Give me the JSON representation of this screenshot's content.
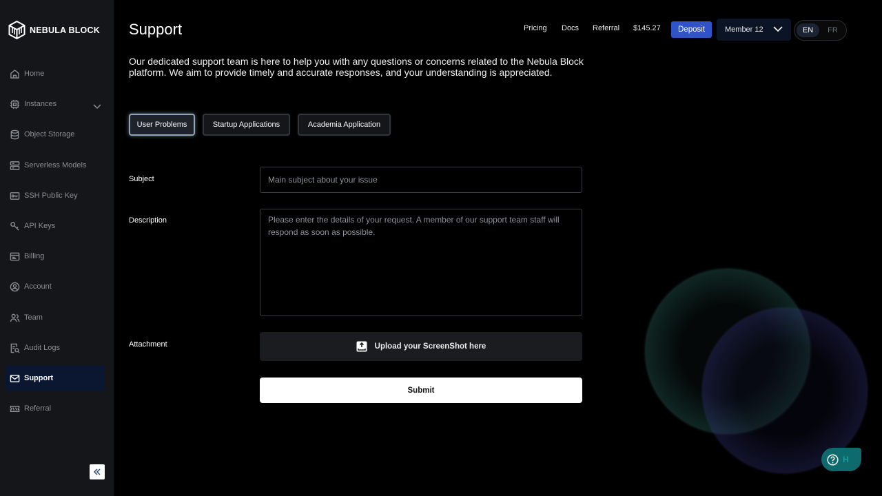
{
  "brand": {
    "name": "NEBULA BLOCK"
  },
  "sidebar": {
    "items": [
      {
        "label": "Home",
        "icon": "home-icon"
      },
      {
        "label": "Instances",
        "icon": "chip-icon"
      },
      {
        "label": "Object Storage",
        "icon": "database-icon"
      },
      {
        "label": "Serverless Models",
        "icon": "server-icon"
      },
      {
        "label": "SSH Public Key",
        "icon": "key-card-icon"
      },
      {
        "label": "API Keys",
        "icon": "key-icon"
      },
      {
        "label": "Billing",
        "icon": "billing-icon"
      },
      {
        "label": "Account",
        "icon": "user-circle-icon"
      },
      {
        "label": "Team",
        "icon": "team-icon"
      },
      {
        "label": "Audit Logs",
        "icon": "audit-icon"
      },
      {
        "label": "Support",
        "icon": "mail-icon",
        "active": true
      },
      {
        "label": "Referral",
        "icon": "ticket-icon"
      }
    ]
  },
  "header": {
    "title": "Support",
    "links": {
      "pricing": "Pricing",
      "docs": "Docs",
      "referral": "Referral"
    },
    "balance": "$145.27",
    "deposit": "Deposit",
    "member": "Member 12",
    "lang": {
      "en": "EN",
      "fr": "FR",
      "selected": "EN"
    }
  },
  "intro": "Our dedicated support team is here to help you with any questions or concerns related to the Nebula Block platform. We aim to provide timely and accurate responses, and your understanding is appreciated.",
  "tabs": [
    {
      "label": "User Problems",
      "active": true
    },
    {
      "label": "Startup Applications"
    },
    {
      "label": "Academia Application"
    }
  ],
  "form": {
    "subject_label": "Subject",
    "subject_placeholder": "Main subject about your issue",
    "subject_value": "",
    "description_label": "Description",
    "description_placeholder": "Please enter the details of your request. A member of our support team staff will respond as soon as possible.",
    "description_value": "",
    "attachment_label": "Attachment",
    "upload_label": "Upload your ScreenShot here",
    "submit_label": "Submit"
  },
  "help": {
    "label": "H"
  },
  "colors": {
    "accent": "#3153c9",
    "sidebar_bg": "#141619",
    "active_nav_bg": "#0b1730",
    "help_bg": "#0e6a6c"
  }
}
